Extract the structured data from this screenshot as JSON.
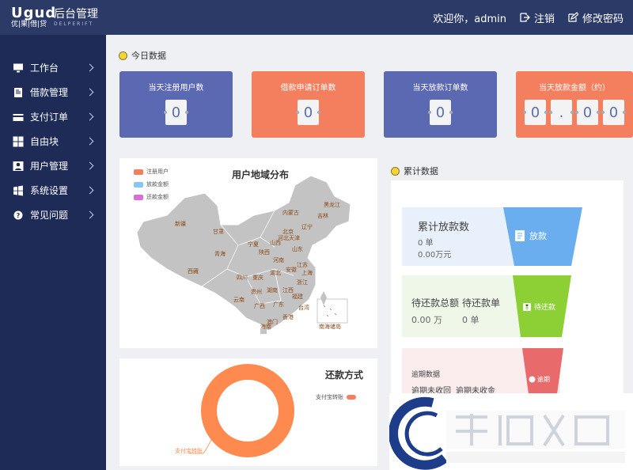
{
  "header": {
    "logo_mark": "Ugud",
    "logo_sub": "优|果|借|贷",
    "logo_title": "后台管理",
    "logo_en": "DELPERIFT",
    "welcome": "欢迎你，admin",
    "logout_label": "注销",
    "change_password_label": "修改密码"
  },
  "sidebar": {
    "items": [
      {
        "label": "工作台",
        "icon": "monitor-icon"
      },
      {
        "label": "借款管理",
        "icon": "document-icon"
      },
      {
        "label": "支付订单",
        "icon": "card-icon"
      },
      {
        "label": "自由块",
        "icon": "grid-icon"
      },
      {
        "label": "用户管理",
        "icon": "user-icon"
      },
      {
        "label": "系统设置",
        "icon": "windows-icon"
      },
      {
        "label": "常见问题",
        "icon": "question-icon"
      }
    ]
  },
  "today": {
    "title": "今日数据",
    "cards": [
      {
        "label": "当天注册用户数",
        "digits": [
          "0"
        ],
        "color": "#5b69b2"
      },
      {
        "label": "借款申请订单数",
        "digits": [
          "0"
        ],
        "color": "#f47f5e"
      },
      {
        "label": "当天放款订单数",
        "digits": [
          "0"
        ],
        "color": "#5b69b2"
      },
      {
        "label": "当天放款金额（约）",
        "digits": [
          "0",
          ".",
          "0",
          "0"
        ],
        "color": "#f47f5e"
      }
    ]
  },
  "map": {
    "title": "用户地域分布",
    "legend": [
      {
        "label": "注册用户",
        "color": "#f47f5e"
      },
      {
        "label": "放款金额",
        "color": "#86c6f4"
      },
      {
        "label": "还款金额",
        "color": "#d86fd6"
      }
    ],
    "provinces": [
      "黑龙江",
      "吉林",
      "内蒙古",
      "辽宁",
      "北京",
      "天津",
      "新疆",
      "甘肃",
      "宁夏",
      "山西",
      "河北",
      "山东",
      "青海",
      "陕西",
      "河南",
      "江苏",
      "西藏",
      "四川",
      "重庆",
      "湖北",
      "安徽",
      "上海",
      "浙江",
      "贵州",
      "湖南",
      "江西",
      "云南",
      "广西",
      "广东",
      "福建",
      "台湾",
      "澳门",
      "香港",
      "海南",
      "南海诸岛"
    ]
  },
  "repay": {
    "title": "还款方式",
    "legend_label": "支付宝转账",
    "slice_label": "支付宝转账",
    "color": "#fe8a4f"
  },
  "cumulative": {
    "title": "累计数据",
    "block1": {
      "title": "累计放款数",
      "line1": "0 单",
      "line2": "0.00万元",
      "badge": "放款",
      "bg": "#e8f0fb",
      "accent": "#6aaef0"
    },
    "block2": {
      "title_a": "待还款总额",
      "title_b": "待还款单",
      "value_a": "0.00 万",
      "value_b": "0 单",
      "badge": "待还款",
      "bg": "#eef7e8",
      "accent": "#8cd035"
    },
    "block3": {
      "title": "逾期数据",
      "sub_a": "逾期未收回",
      "sub_b": "逾期未收金",
      "badge": "逾期",
      "bg": "#fbeced",
      "accent": "#e86a6a"
    }
  }
}
